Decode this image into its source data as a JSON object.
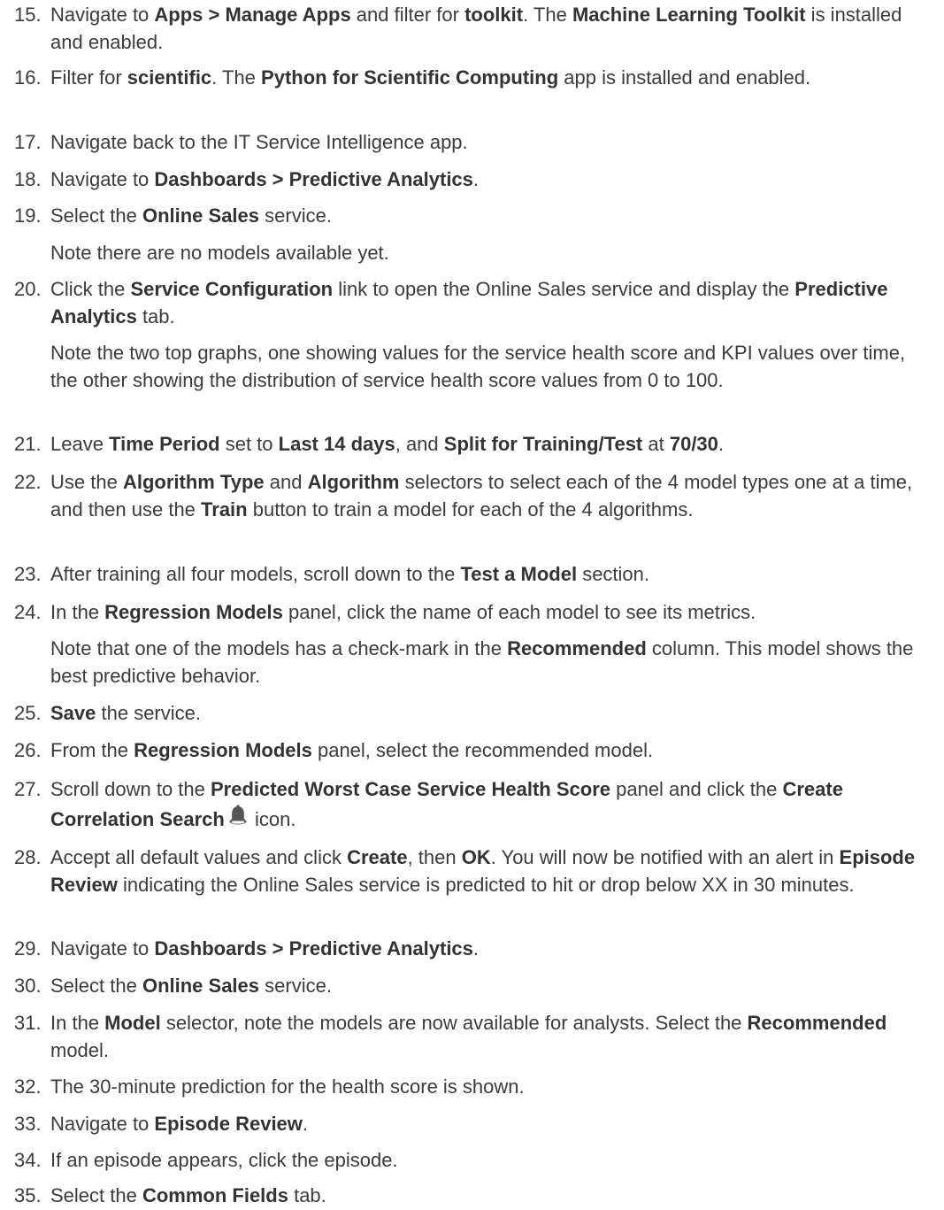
{
  "steps": [
    {
      "n": "15.",
      "segs": [
        "Navigate to ",
        "Apps > Manage Apps",
        " and filter for ",
        "toolkit",
        ". The ",
        "Machine Learning Toolkit",
        " is installed and enabled."
      ]
    },
    {
      "n": "16.",
      "segs": [
        "Filter for ",
        "scientific",
        ". The ",
        "Python for Scientific Computing",
        " app is installed and enabled."
      ]
    },
    {
      "n": "17.",
      "segs": [
        "Navigate back to the IT Service Intelligence app."
      ]
    },
    {
      "n": "18.",
      "segs": [
        "Navigate to ",
        "Dashboards > Predictive Analytics",
        "."
      ]
    },
    {
      "n": "19.",
      "segs": [
        "Select the ",
        "Online Sales",
        " service."
      ]
    },
    {
      "note": "Note there are no models available yet."
    },
    {
      "n": "20.",
      "segs": [
        "Click the ",
        "Service Configuration",
        " link to open the Online Sales service and display the ",
        "Predictive Analytics",
        " tab."
      ]
    },
    {
      "note": "Note the two top graphs, one showing values for the service health score and KPI values over time, the other showing the distribution of service health score values from 0 to 100."
    },
    {
      "n": "21.",
      "segs": [
        "Leave ",
        "Time Period",
        " set to ",
        "Last 14 days",
        ", and ",
        "Split for Training/Test",
        " at ",
        "70/30",
        "."
      ]
    },
    {
      "n": "22.",
      "segs": [
        "Use the ",
        "Algorithm Type",
        " and ",
        "Algorithm",
        " selectors to select each of the 4 model types one at a time, and then use the ",
        "Train",
        " button to train a model for each of the 4 algorithms."
      ]
    },
    {
      "n": "23.",
      "segs": [
        "After training all four models, scroll down to the ",
        "Test a Model",
        " section."
      ]
    },
    {
      "n": "24.",
      "segs": [
        "In the ",
        "Regression Models",
        " panel, click the name of each model to see its metrics."
      ]
    },
    {
      "note_segs": [
        "Note that one of the models has a check-mark in the ",
        "Recommended",
        " column. This model shows the best predictive behavior."
      ]
    },
    {
      "n": "25.",
      "segs": [
        "",
        "Save",
        " the service."
      ]
    },
    {
      "n": "26.",
      "segs": [
        "From the ",
        "Regression Models",
        " panel, select the recommended model."
      ]
    },
    {
      "n": "27.",
      "segs": [
        "Scroll down to the ",
        "Predicted Worst Case Service Health Score",
        " panel and click the ",
        "Create Correlation Search",
        "",
        "",
        " icon."
      ]
    },
    {
      "n": "28.",
      "segs": [
        "Accept all default values and click ",
        "Create",
        ", then ",
        "OK",
        ". You will now be notified with an alert in ",
        "Episode Review",
        " indicating the Online Sales service is predicted to hit or drop below XX in 30 minutes."
      ]
    },
    {
      "n": "29.",
      "segs": [
        "Navigate to ",
        "Dashboards > Predictive Analytics",
        "."
      ]
    },
    {
      "n": "30.",
      "segs": [
        "Select the ",
        "Online Sales",
        " service."
      ]
    },
    {
      "n": "31.",
      "segs": [
        "In the ",
        "Model",
        " selector, note the models are now available for analysts. Select the ",
        "Recommended",
        " model."
      ]
    },
    {
      "n": "32.",
      "segs": [
        "The 30-minute prediction for the health score is shown."
      ]
    },
    {
      "n": "33.",
      "segs": [
        "Navigate to ",
        "Episode Review",
        "."
      ]
    },
    {
      "n": "34.",
      "segs": [
        "If an episode appears, click the episode."
      ]
    },
    {
      "n": "35.",
      "segs": [
        "Select the ",
        "Common Fields",
        " tab."
      ]
    }
  ],
  "icons": {
    "bell": "bell-icon"
  }
}
